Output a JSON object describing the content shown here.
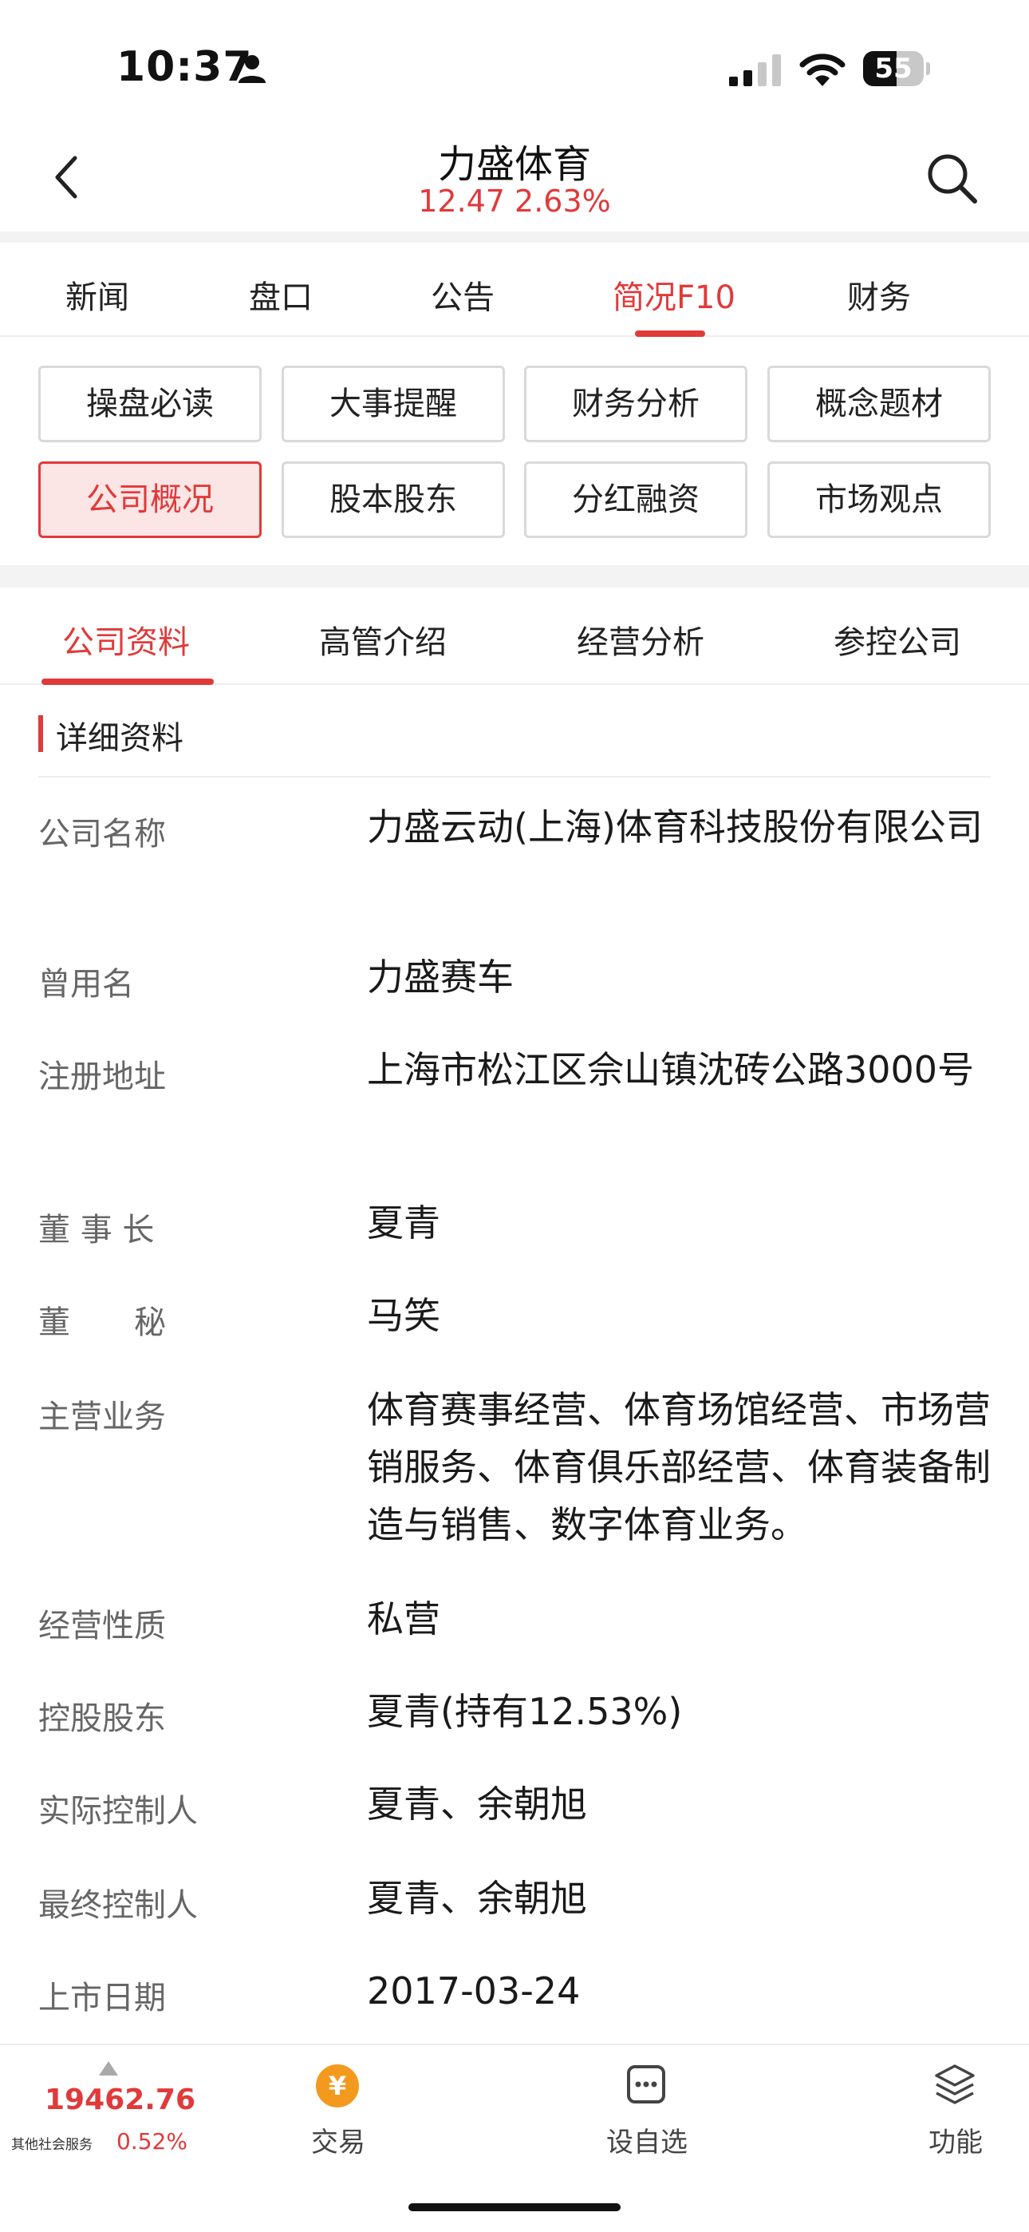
{
  "status_bar": {
    "time": "10:37",
    "battery": "55",
    "battery_level": 0.55,
    "icons": [
      "person-icon",
      "signal-icon",
      "wifi-icon",
      "battery-icon"
    ]
  },
  "header": {
    "title": "力盛体育",
    "price": "12.47",
    "change": "2.63%",
    "accent_color": "#e03a3a"
  },
  "main_tabs": [
    {
      "label": "新闻"
    },
    {
      "label": "盘口"
    },
    {
      "label": "公告"
    },
    {
      "label": "简况F10",
      "active": true
    },
    {
      "label": "财务"
    }
  ],
  "buttons": [
    {
      "label": "操盘必读"
    },
    {
      "label": "大事提醒"
    },
    {
      "label": "财务分析"
    },
    {
      "label": "概念题材"
    },
    {
      "label": "公司概况",
      "active": true
    },
    {
      "label": "股本股东"
    },
    {
      "label": "分红融资"
    },
    {
      "label": "市场观点"
    }
  ],
  "sub_tabs": [
    {
      "label": "公司资料",
      "active": true
    },
    {
      "label": "高管介绍"
    },
    {
      "label": "经营分析"
    },
    {
      "label": "参控公司"
    }
  ],
  "section": {
    "title": "详细资料"
  },
  "details": [
    {
      "label": "公司名称",
      "value": "力盛云动(上海)体育科技股份有限公司"
    },
    {
      "label": "曾用名",
      "value": "力盛赛车"
    },
    {
      "label": "注册地址",
      "value": "上海市松江区佘山镇沈砖公路3000号"
    },
    {
      "label": "董 事 长",
      "value": "夏青"
    },
    {
      "label": "董　　秘",
      "value": "马笑"
    },
    {
      "label": "主营业务",
      "value": "体育赛事经营、体育场馆经营、市场营销服务、体育俱乐部经营、体育装备制造与销售、数字体育业务。"
    },
    {
      "label": "经营性质",
      "value": "私营"
    },
    {
      "label": "控股股东",
      "value": "夏青(持有12.53%)"
    },
    {
      "label": "实际控制人",
      "value": "夏青、余朝旭"
    },
    {
      "label": "最终控制人",
      "value": "夏青、余朝旭"
    },
    {
      "label": "上市日期",
      "value": "2017-03-24"
    }
  ],
  "bottom_bar": {
    "index_value": "19462.76",
    "index_name": "其他社会服务",
    "index_change": "0.52%",
    "trade_icon_glyph": "¥",
    "trade_label": "交易",
    "watchlist_label": "设自选",
    "functions_label": "功能"
  }
}
